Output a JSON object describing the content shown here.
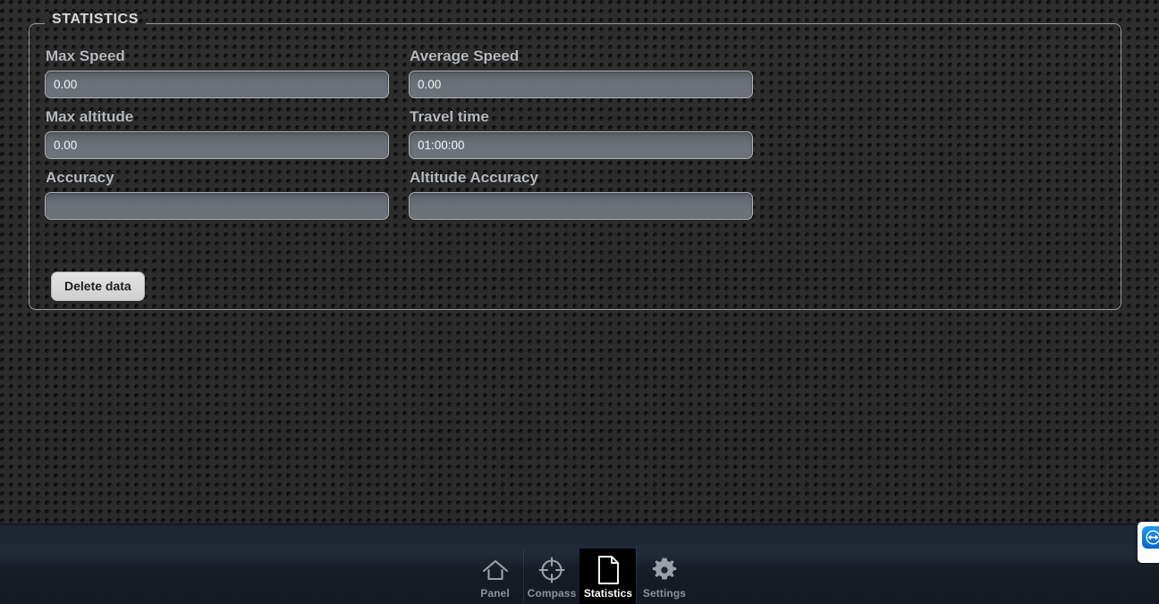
{
  "screen": {
    "title": "Statistics",
    "accent_blue": "#0a63c9",
    "panel_border": "#9a9a9a",
    "background": "#2b2b2b",
    "tabbar_background": "#1b2430"
  },
  "statistics_panel": {
    "legend": "STATISTICS",
    "fields": [
      {
        "label": "Max Speed",
        "value": "0.00",
        "placeholder": "",
        "name": "max-speed"
      },
      {
        "label": "Average Speed",
        "value": "0.00",
        "placeholder": "",
        "name": "average-speed"
      },
      {
        "label": "Max altitude",
        "value": "0.00",
        "placeholder": "",
        "name": "max-altitude"
      },
      {
        "label": "Travel time",
        "value": "01:00:00",
        "placeholder": "",
        "name": "travel-time"
      },
      {
        "label": "Accuracy",
        "value": "",
        "placeholder": "",
        "name": "accuracy"
      },
      {
        "label": "Altitude Accuracy",
        "value": "",
        "placeholder": "",
        "name": "altitude-accuracy"
      }
    ],
    "delete_button_label": "Delete data"
  },
  "tabbar": {
    "tabs": [
      {
        "label": "Panel",
        "icon": "home-icon",
        "active": false
      },
      {
        "label": "Compass",
        "icon": "compass-icon",
        "active": false
      },
      {
        "label": "Statistics",
        "icon": "document-icon",
        "active": true
      },
      {
        "label": "Settings",
        "icon": "gear-icon",
        "active": false
      }
    ]
  },
  "overlay": {
    "teamviewer": {
      "icon": "teamviewer-icon",
      "label": ""
    }
  }
}
